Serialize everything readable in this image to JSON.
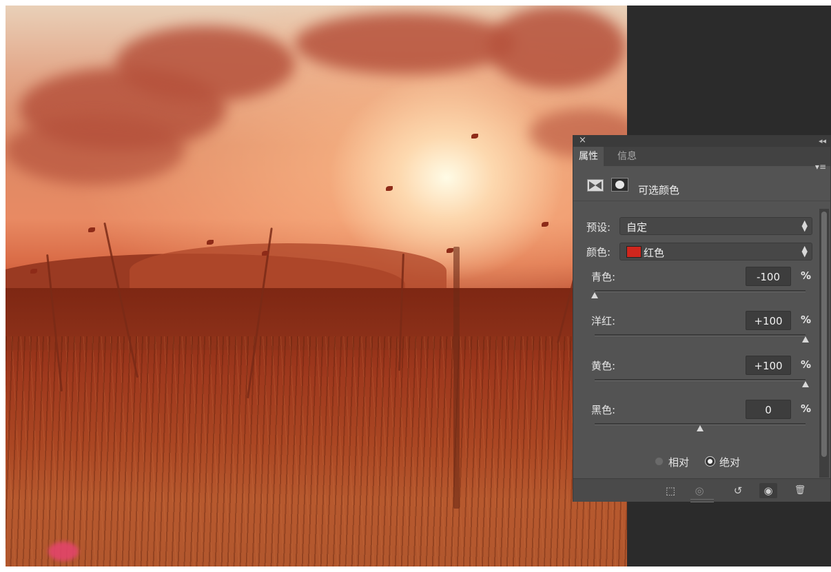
{
  "panel": {
    "titlebar": {
      "close_glyph": "×",
      "collapse_glyph": "◂◂"
    },
    "tabs": [
      {
        "label": "属性",
        "active": true
      },
      {
        "label": "信息",
        "active": false
      }
    ],
    "menu_glyph": "▾≡",
    "adjustment": {
      "icons": [
        "selective-color-adjustment-icon",
        "layer-mask-icon"
      ],
      "title": "可选颜色"
    },
    "preset": {
      "label": "预设:",
      "value": "自定"
    },
    "colors": {
      "label": "颜色:",
      "value": "红色",
      "swatch_color": "#d0261d"
    },
    "sliders": [
      {
        "label": "青色:",
        "value": "-100",
        "unit": "%",
        "level": -100
      },
      {
        "label": "洋红:",
        "value": "+100",
        "unit": "%",
        "level": 100
      },
      {
        "label": "黄色:",
        "value": "+100",
        "unit": "%",
        "level": 100
      },
      {
        "label": "黑色:",
        "value": "0",
        "unit": "%",
        "level": 0
      }
    ],
    "method": {
      "options": [
        {
          "label": "相对",
          "selected": false
        },
        {
          "label": "绝对",
          "selected": true
        }
      ]
    },
    "footer": {
      "buttons": [
        {
          "icon": "clip-to-layer-icon",
          "glyph": "⬚"
        },
        {
          "icon": "view-previous-state-icon",
          "glyph": "◎"
        },
        {
          "icon": "reset-icon",
          "glyph": "↺"
        },
        {
          "icon": "visibility-eye-icon",
          "glyph": "◉"
        },
        {
          "icon": "delete-trash-icon",
          "glyph": "🗑"
        }
      ]
    }
  },
  "colors": {
    "panel_bg": "#535353",
    "app_bg": "#2b2b2b",
    "accent_red": "#d0261d"
  }
}
